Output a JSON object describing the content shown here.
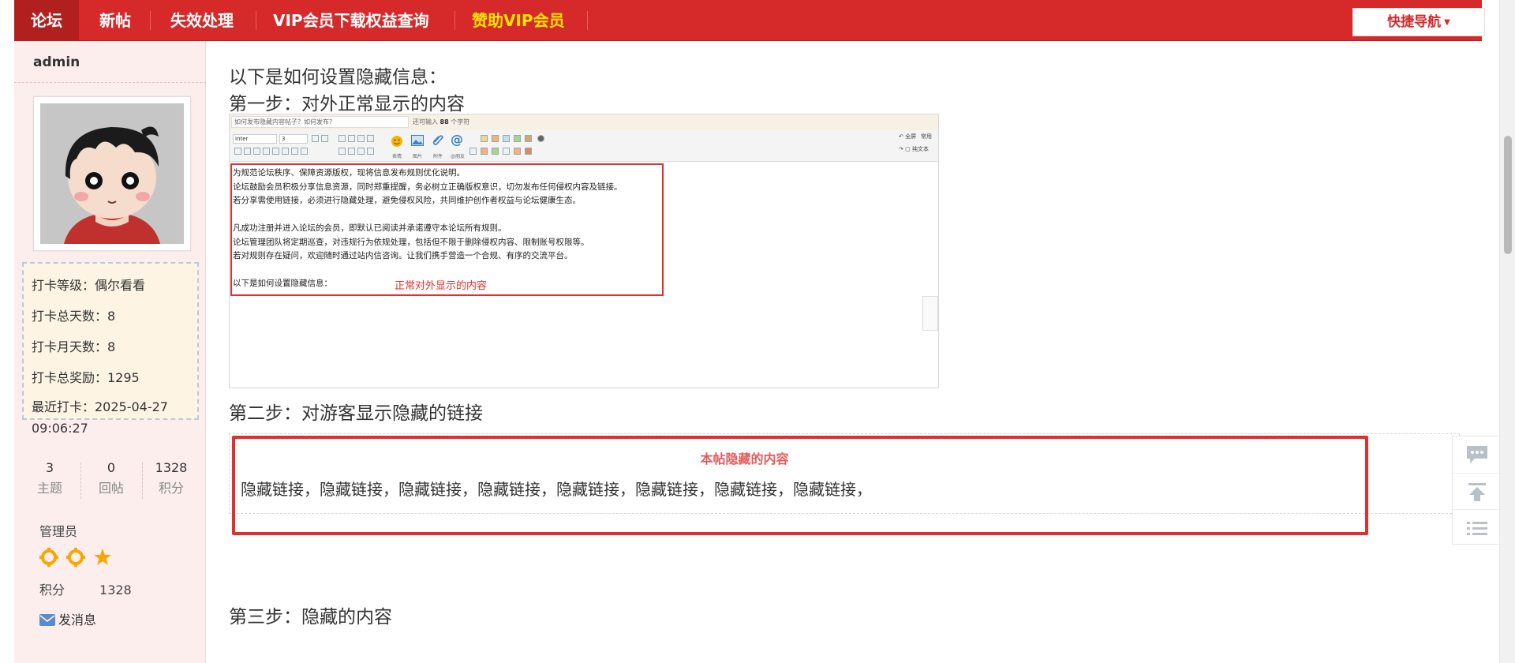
{
  "topnav": {
    "items": [
      {
        "label": "论坛"
      },
      {
        "label": "新帖"
      },
      {
        "label": "失效处理"
      },
      {
        "label": "VIP会员下载权益查询"
      },
      {
        "label": "赞助VIP会员"
      }
    ],
    "quick_nav_label": "快捷导航"
  },
  "sidebar": {
    "username": "admin",
    "checkin": {
      "level": "打卡等级：偶尔看看",
      "total_days": "打卡总天数：8",
      "month_days": "打卡月天数：8",
      "total_reward": "打卡总奖励：1295",
      "last_checkin": "最近打卡：2025-04-27 09:06:27"
    },
    "stats": [
      {
        "value": "3",
        "label": "主题"
      },
      {
        "value": "0",
        "label": "回帖"
      },
      {
        "value": "1328",
        "label": "积分"
      }
    ],
    "role": "管理员",
    "points_label": "积分",
    "points_value": "1328",
    "message_label": "发消息"
  },
  "content": {
    "heading_intro": "以下是如何设置隐藏信息：",
    "step1": "第一步：对外正常显示的内容",
    "step2": "第二步：对游客显示隐藏的链接",
    "step3": "第三步：隐藏的内容",
    "editor_screenshot": {
      "title_placeholder": "如何发布隐藏内容帖子？如何发布?",
      "remaining_prefix": "还可输入",
      "remaining_count": "88",
      "remaining_suffix": "个字符",
      "font_select": "Inter",
      "size_select": "3",
      "toolbar_labels": [
        "表情",
        "图片",
        "附件",
        "@朋友"
      ],
      "right_labels": [
        "全屏",
        "常用",
        "纯文本"
      ],
      "body_lines": [
        "为规范论坛秩序、保障资源版权，现将信息发布规则优化说明。",
        "论坛鼓励会员积极分享信息资源，同时郑重提醒，务必树立正确版权意识，切勿发布任何侵权内容及链接。",
        "若分享需使用链接，必须进行隐藏处理，避免侵权风险，共同维护创作者权益与论坛健康生态。",
        "",
        "凡成功注册并进入论坛的会员，即默认已阅读并承诺遵守本论坛所有规则。",
        "论坛管理团队将定期巡查，对违规行为依规处理，包括但不限于删除侵权内容、限制账号权限等。",
        "若对规则存在疑问，欢迎随时通过站内信咨询。让我们携手营造一个合规、有序的交流平台。",
        "",
        "以下是如何设置隐藏信息："
      ],
      "annotation": "正常对外显示的内容"
    },
    "hidden_box": {
      "title": "本帖隐藏的内容",
      "links": "隐藏链接，隐藏链接，隐藏链接，隐藏链接，隐藏链接，隐藏链接，隐藏链接，隐藏链接，"
    }
  },
  "colors": {
    "nav_red": "#d62929",
    "vip_yellow": "#ffe600",
    "annotation_red": "#e12e2e",
    "sidebar_bg": "#fdeeee"
  },
  "icons": [
    "chevron-down-icon",
    "avatar",
    "gear-star-icon",
    "star-icon",
    "envelope-icon",
    "comment-icon",
    "back-to-top-icon",
    "list-icon"
  ]
}
